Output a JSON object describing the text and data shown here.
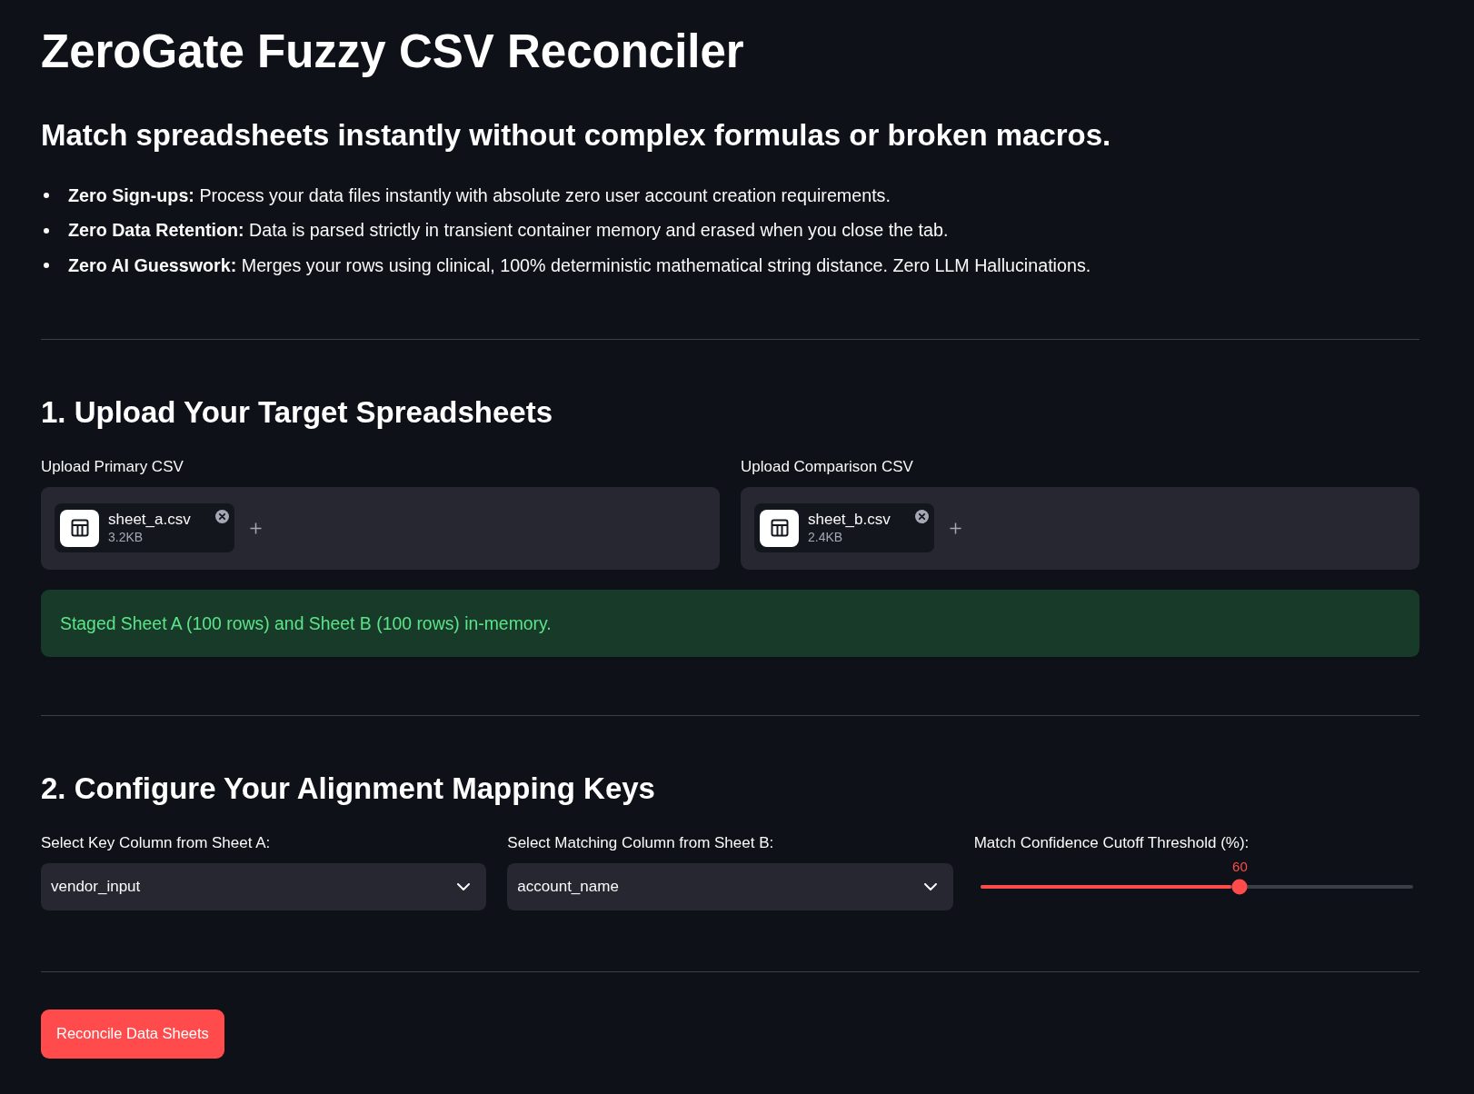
{
  "title": "ZeroGate Fuzzy CSV Reconciler",
  "subtitle": "Match spreadsheets instantly without complex formulas or broken macros.",
  "features": [
    "**Zero Sign-ups:** Process your data files instantly with absolute zero user account creation requirements.",
    "**Zero Data Retention:** Data is parsed strictly in transient container memory and erased when you close the tab.",
    "**Zero AI Guesswork:** Merges your rows using clinical, 100% deterministic mathematical string distance. Zero LLM Hallucinations."
  ],
  "upload_section": {
    "heading": "1. Upload Your Target Spreadsheets",
    "uploaders": [
      {
        "label": "Upload Primary CSV",
        "files": [
          {
            "name": "sheet_a.csv",
            "size": "3.2KB"
          }
        ]
      },
      {
        "label": "Upload Comparison CSV",
        "files": [
          {
            "name": "sheet_b.csv",
            "size": "2.4KB"
          }
        ]
      }
    ]
  },
  "status": {
    "kind": "success",
    "text": "Staged Sheet A (100 rows) and Sheet B (100 rows) in-memory."
  },
  "mapping_section": {
    "heading": "2. Configure Your Alignment Mapping Keys",
    "selects": [
      {
        "label": "Select Key Column from Sheet A:",
        "value": "vendor_input"
      },
      {
        "label": "Select Matching Column from Sheet B:",
        "value": "account_name"
      }
    ],
    "slider": {
      "label": "Match Confidence Cutoff Threshold (%):",
      "value": "60",
      "level": 0.6
    }
  },
  "action_button": {
    "label": "Reconcile Data Sheets"
  }
}
